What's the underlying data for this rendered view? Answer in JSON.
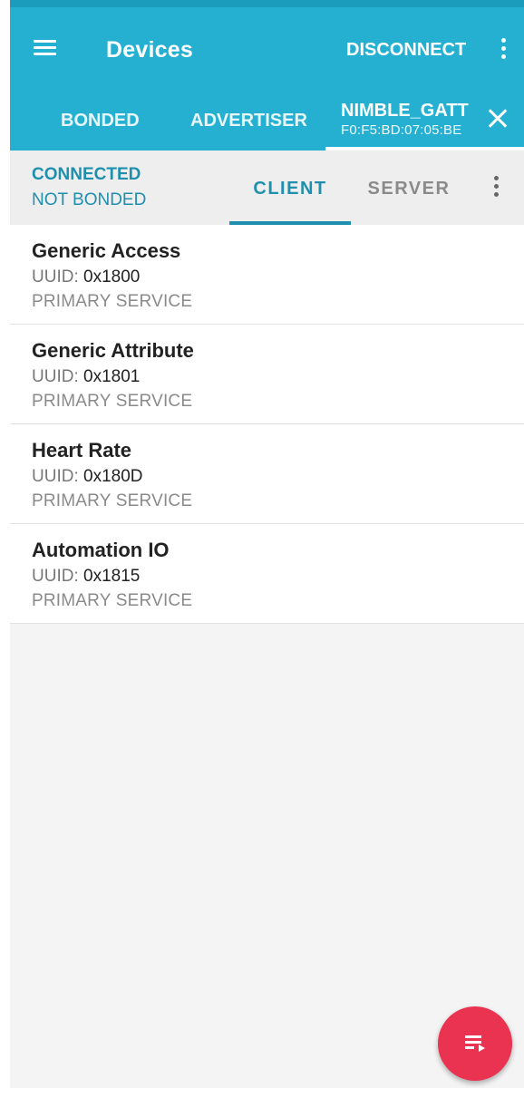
{
  "theme": {
    "primary": "#25b0d2",
    "accent_text": "#1f8fae",
    "fab_color": "#ea3350"
  },
  "toolbar": {
    "menu_icon": "hamburger-menu-icon",
    "title": "Devices",
    "disconnect_label": "DISCONNECT",
    "more_icon": "overflow-menu-icon"
  },
  "tabs": {
    "bonded": "BONDED",
    "advertiser": "ADVERTISER",
    "device": {
      "name": "NIMBLE_GATT",
      "address": "F0:F5:BD:07:05:BE",
      "close_icon": "close-icon"
    }
  },
  "connection": {
    "state": "CONNECTED",
    "bond": "NOT BONDED",
    "tabs": [
      "CLIENT",
      "SERVER"
    ],
    "selected_tab": "CLIENT"
  },
  "services": [
    {
      "name": "Generic Access",
      "uuid_label": "UUID:",
      "uuid": "0x1800",
      "type": "PRIMARY SERVICE"
    },
    {
      "name": "Generic Attribute",
      "uuid_label": "UUID:",
      "uuid": "0x1801",
      "type": "PRIMARY SERVICE"
    },
    {
      "name": "Heart Rate",
      "uuid_label": "UUID:",
      "uuid": "0x180D",
      "type": "PRIMARY SERVICE"
    },
    {
      "name": "Automation IO",
      "uuid_label": "UUID:",
      "uuid": "0x1815",
      "type": "PRIMARY SERVICE"
    }
  ],
  "fab": {
    "icon": "log-playlist-icon"
  }
}
